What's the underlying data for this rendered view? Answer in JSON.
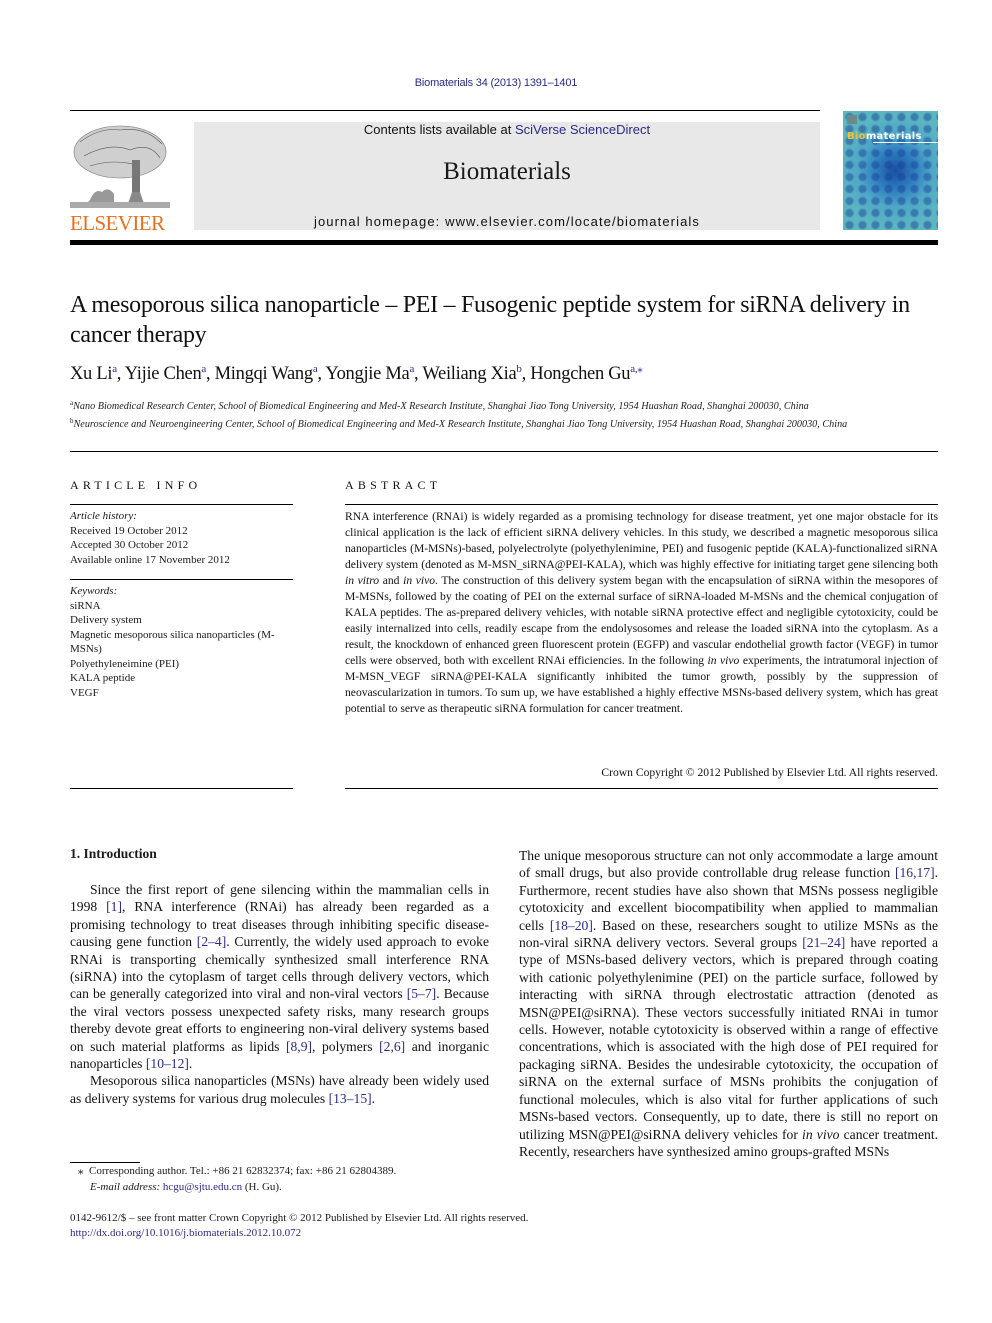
{
  "citation": "Biomaterials 34 (2013) 1391–1401",
  "header": {
    "publisher": "ELSEVIER",
    "contents_prefix": "Contents lists available at ",
    "contents_link": "SciVerse ScienceDirect",
    "journal": "Biomaterials",
    "homepage": "journal homepage: www.elsevier.com/locate/biomaterials",
    "cover_title_highlight": "Bio",
    "cover_title_rest": "materials"
  },
  "article": {
    "title": "A mesoporous silica nanoparticle – PEI – Fusogenic peptide system for siRNA delivery in cancer therapy",
    "authors": [
      {
        "name": "Xu Li",
        "aff": "a"
      },
      {
        "name": "Yijie Chen",
        "aff": "a"
      },
      {
        "name": "Mingqi Wang",
        "aff": "a"
      },
      {
        "name": "Yongjie Ma",
        "aff": "a"
      },
      {
        "name": "Weiliang Xia",
        "aff": "b"
      },
      {
        "name": "Hongchen Gu",
        "aff": "a,⁎"
      }
    ],
    "affiliations": [
      {
        "key": "a",
        "text": "Nano Biomedical Research Center, School of Biomedical Engineering and Med-X Research Institute, Shanghai Jiao Tong University, 1954 Huashan Road, Shanghai 200030, China"
      },
      {
        "key": "b",
        "text": "Neuroscience and Neuroengineering Center, School of Biomedical Engineering and Med-X Research Institute, Shanghai Jiao Tong University, 1954 Huashan Road, Shanghai 200030, China"
      }
    ]
  },
  "article_info": {
    "heading": "ARTICLE INFO",
    "history_label": "Article history:",
    "history": [
      "Received 19 October 2012",
      "Accepted 30 October 2012",
      "Available online 17 November 2012"
    ],
    "keywords_label": "Keywords:",
    "keywords": [
      "siRNA",
      "Delivery system",
      "Magnetic mesoporous silica nanoparticles (M-MSNs)",
      "Polyethyleneimine (PEI)",
      "KALA peptide",
      "VEGF"
    ]
  },
  "abstract": {
    "heading": "ABSTRACT",
    "segments": [
      {
        "t": "RNA interference (RNAi) is widely regarded as a promising technology for disease treatment, yet one major obstacle for its clinical application is the lack of efficient siRNA delivery vehicles. In this study, we described a magnetic mesoporous silica nanoparticles (M-MSNs)-based, polyelectrolyte (polyethylenimine, PEI) and fusogenic peptide (KALA)-functionalized siRNA delivery system (denoted as M-MSN_siRNA@PEI-KALA), which was highly effective for initiating target gene silencing both ",
        "i": false
      },
      {
        "t": "in vitro",
        "i": true
      },
      {
        "t": " and ",
        "i": false
      },
      {
        "t": "in vivo",
        "i": true
      },
      {
        "t": ". The construction of this delivery system began with the encapsulation of siRNA within the mesopores of M-MSNs, followed by the coating of PEI on the external surface of siRNA-loaded M-MSNs and the chemical conjugation of KALA peptides. The as-prepared delivery vehicles, with notable siRNA protective effect and negligible cytotoxicity, could be easily internalized into cells, readily escape from the endolysosomes and release the loaded siRNA into the cytoplasm. As a result, the knockdown of enhanced green fluorescent protein (EGFP) and vascular endothelial growth factor (VEGF) in tumor cells were observed, both with excellent RNAi efficiencies. In the following ",
        "i": false
      },
      {
        "t": "in vivo",
        "i": true
      },
      {
        "t": " experiments, the intratumoral injection of M-MSN_VEGF siRNA@PEI-KALA significantly inhibited the tumor growth, possibly by the suppression of neovascularization in tumors. To sum up, we have established a highly effective MSNs-based delivery system, which has great potential to serve as therapeutic siRNA formulation for cancer treatment.",
        "i": false
      }
    ],
    "copyright": "Crown Copyright © 2012 Published by Elsevier Ltd. All rights reserved."
  },
  "intro": {
    "heading": "1.  Introduction",
    "left_paragraphs": [
      [
        {
          "t": "Since the first report of gene silencing within the mammalian cells in 1998 "
        },
        {
          "t": "[1]",
          "ref": true
        },
        {
          "t": ", RNA interference (RNAi) has already been regarded as a promising technology to treat diseases through inhibiting specific disease-causing gene function "
        },
        {
          "t": "[2–4]",
          "ref": true
        },
        {
          "t": ". Currently, the widely used approach to evoke RNAi is transporting chemically synthesized small interference RNA (siRNA) into the cytoplasm of target cells through delivery vectors, which can be generally categorized into viral and non-viral vectors "
        },
        {
          "t": "[5–7]",
          "ref": true
        },
        {
          "t": ". Because the viral vectors possess unexpected safety risks, many research groups thereby devote great efforts to engineering non-viral delivery systems based on such material platforms as lipids "
        },
        {
          "t": "[8,9]",
          "ref": true
        },
        {
          "t": ", polymers "
        },
        {
          "t": "[2,6]",
          "ref": true
        },
        {
          "t": " and inorganic nanoparticles "
        },
        {
          "t": "[10–12]",
          "ref": true
        },
        {
          "t": "."
        }
      ],
      [
        {
          "t": "Mesoporous silica nanoparticles (MSNs) have already been widely used as delivery systems for various drug molecules "
        },
        {
          "t": "[13–15]",
          "ref": true
        },
        {
          "t": "."
        }
      ]
    ],
    "right_paragraph": [
      {
        "t": "The unique mesoporous structure can not only accommodate a large amount of small drugs, but also provide controllable drug release function "
      },
      {
        "t": "[16,17]",
        "ref": true
      },
      {
        "t": ". Furthermore, recent studies have also shown that MSNs possess negligible cytotoxicity and excellent biocompatibility when applied to mammalian cells "
      },
      {
        "t": "[18–20]",
        "ref": true
      },
      {
        "t": ". Based on these, researchers sought to utilize MSNs as the non-viral siRNA delivery vectors. Several groups "
      },
      {
        "t": "[21–24]",
        "ref": true
      },
      {
        "t": " have reported a type of MSNs-based delivery vectors, which is prepared through coating with cationic polyethylenimine (PEI) on the particle surface, followed by interacting with siRNA through electrostatic attraction (denoted as MSN@PEI@siRNA). These vectors successfully initiated RNAi in tumor cells. However, notable cytotoxicity is observed within a range of effective concentrations, which is associated with the high dose of PEI required for packaging siRNA. Besides the undesirable cytotoxicity, the occupation of siRNA on the external surface of MSNs prohibits the conjugation of functional molecules, which is also vital for further applications of such MSNs-based vectors. Consequently, up to date, there is still no report on utilizing MSN@PEI@siRNA delivery vehicles for "
      },
      {
        "t": "in vivo",
        "i": true
      },
      {
        "t": " cancer treatment. Recently, researchers have synthesized amino groups-grafted MSNs"
      }
    ]
  },
  "footnote": {
    "marker": "⁎",
    "corresponding": "Corresponding author. Tel.: +86 21 62832374; fax: +86 21 62804389.",
    "email_label": "E-mail address: ",
    "email": "hcgu@sjtu.edu.cn",
    "email_suffix": " (H. Gu)."
  },
  "bottom": {
    "issn_line": "0142-9612/$ – see front matter Crown Copyright © 2012 Published by Elsevier Ltd. All rights reserved.",
    "doi": "http://dx.doi.org/10.1016/j.biomaterials.2012.10.072"
  },
  "colors": {
    "link": "#2a2a8a",
    "elsevier_orange": "#e9711c",
    "banner_gray": "#e8e8e8"
  }
}
